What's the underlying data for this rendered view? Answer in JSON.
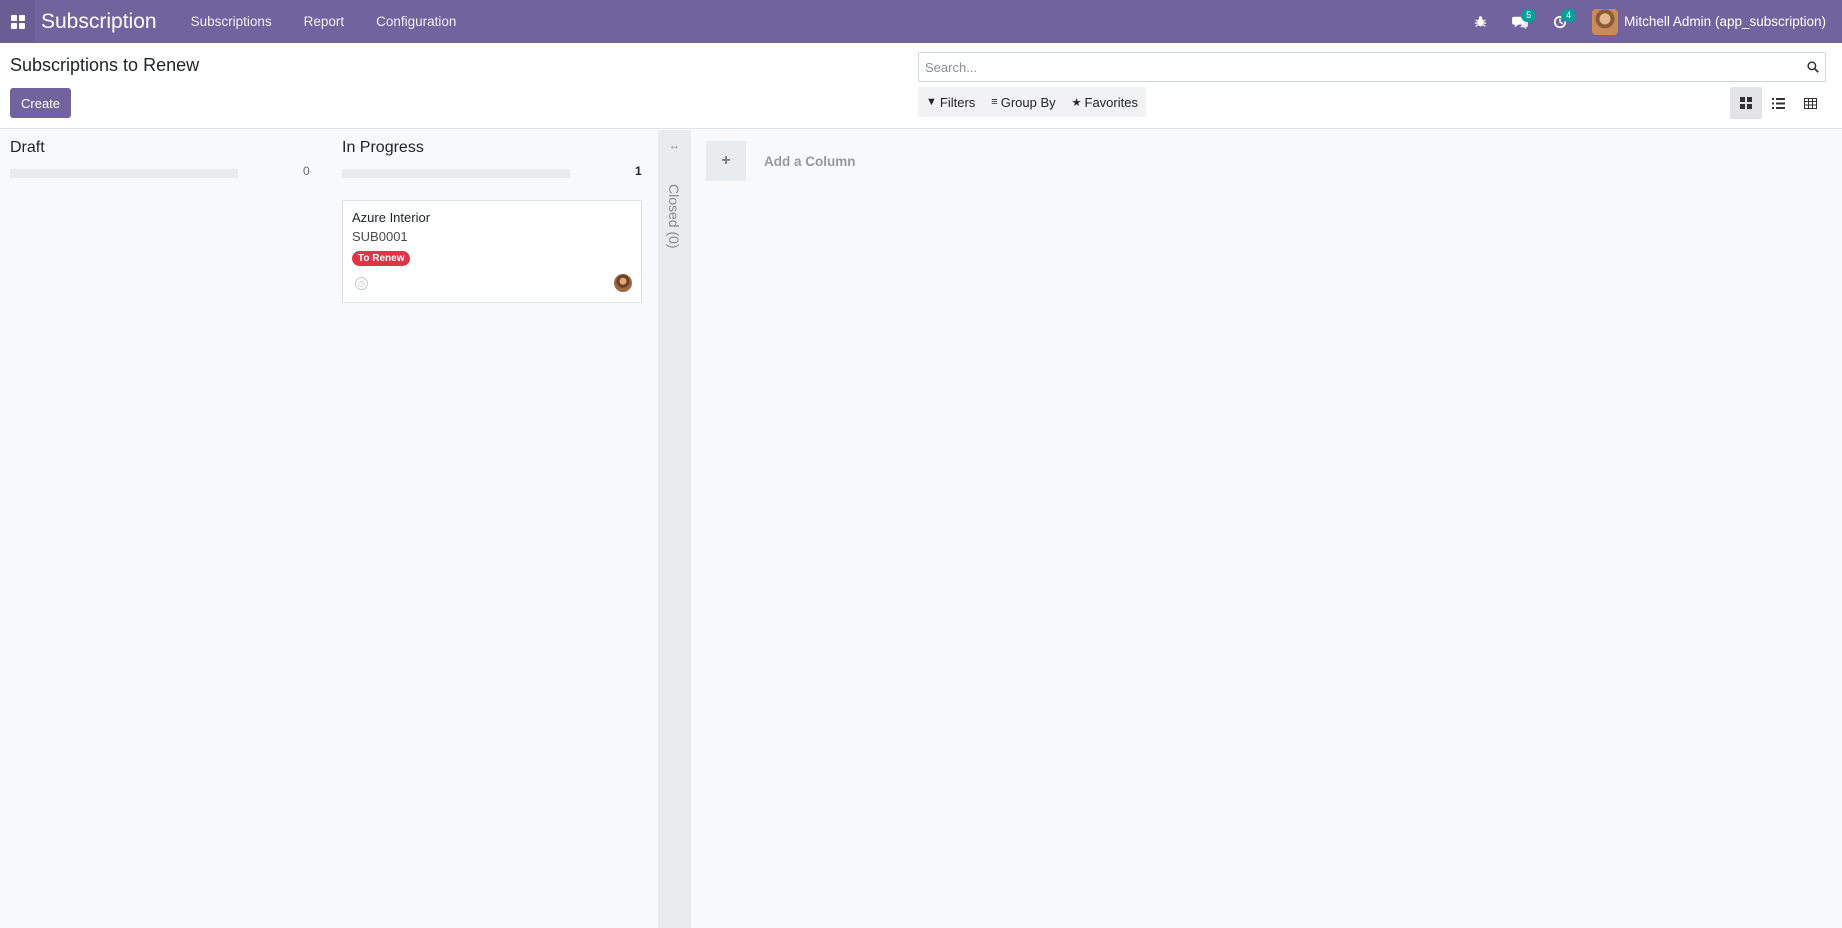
{
  "app": {
    "title": "Subscription"
  },
  "menu": [
    "Subscriptions",
    "Report",
    "Configuration"
  ],
  "systray": {
    "messages_count": "5",
    "activities_count": "4",
    "user_name": "Mitchell Admin (app_subscription)"
  },
  "control_panel": {
    "breadcrumb": "Subscriptions to Renew",
    "create_label": "Create",
    "search_placeholder": "Search...",
    "filters_label": "Filters",
    "groupby_label": "Group By",
    "favorites_label": "Favorites",
    "active_view": "kanban"
  },
  "kanban": {
    "columns": [
      {
        "title": "Draft",
        "count": "0",
        "cards": []
      },
      {
        "title": "In Progress",
        "count": "1",
        "cards": [
          {
            "name": "Azure Interior",
            "code": "SUB0001",
            "tag": "To Renew"
          }
        ]
      }
    ],
    "folded_column": "Closed (0)",
    "add_column_label": "Add a Column"
  },
  "colors": {
    "brand": "#71639e",
    "tag_red": "#dc3545",
    "badge": "#00a09d"
  }
}
